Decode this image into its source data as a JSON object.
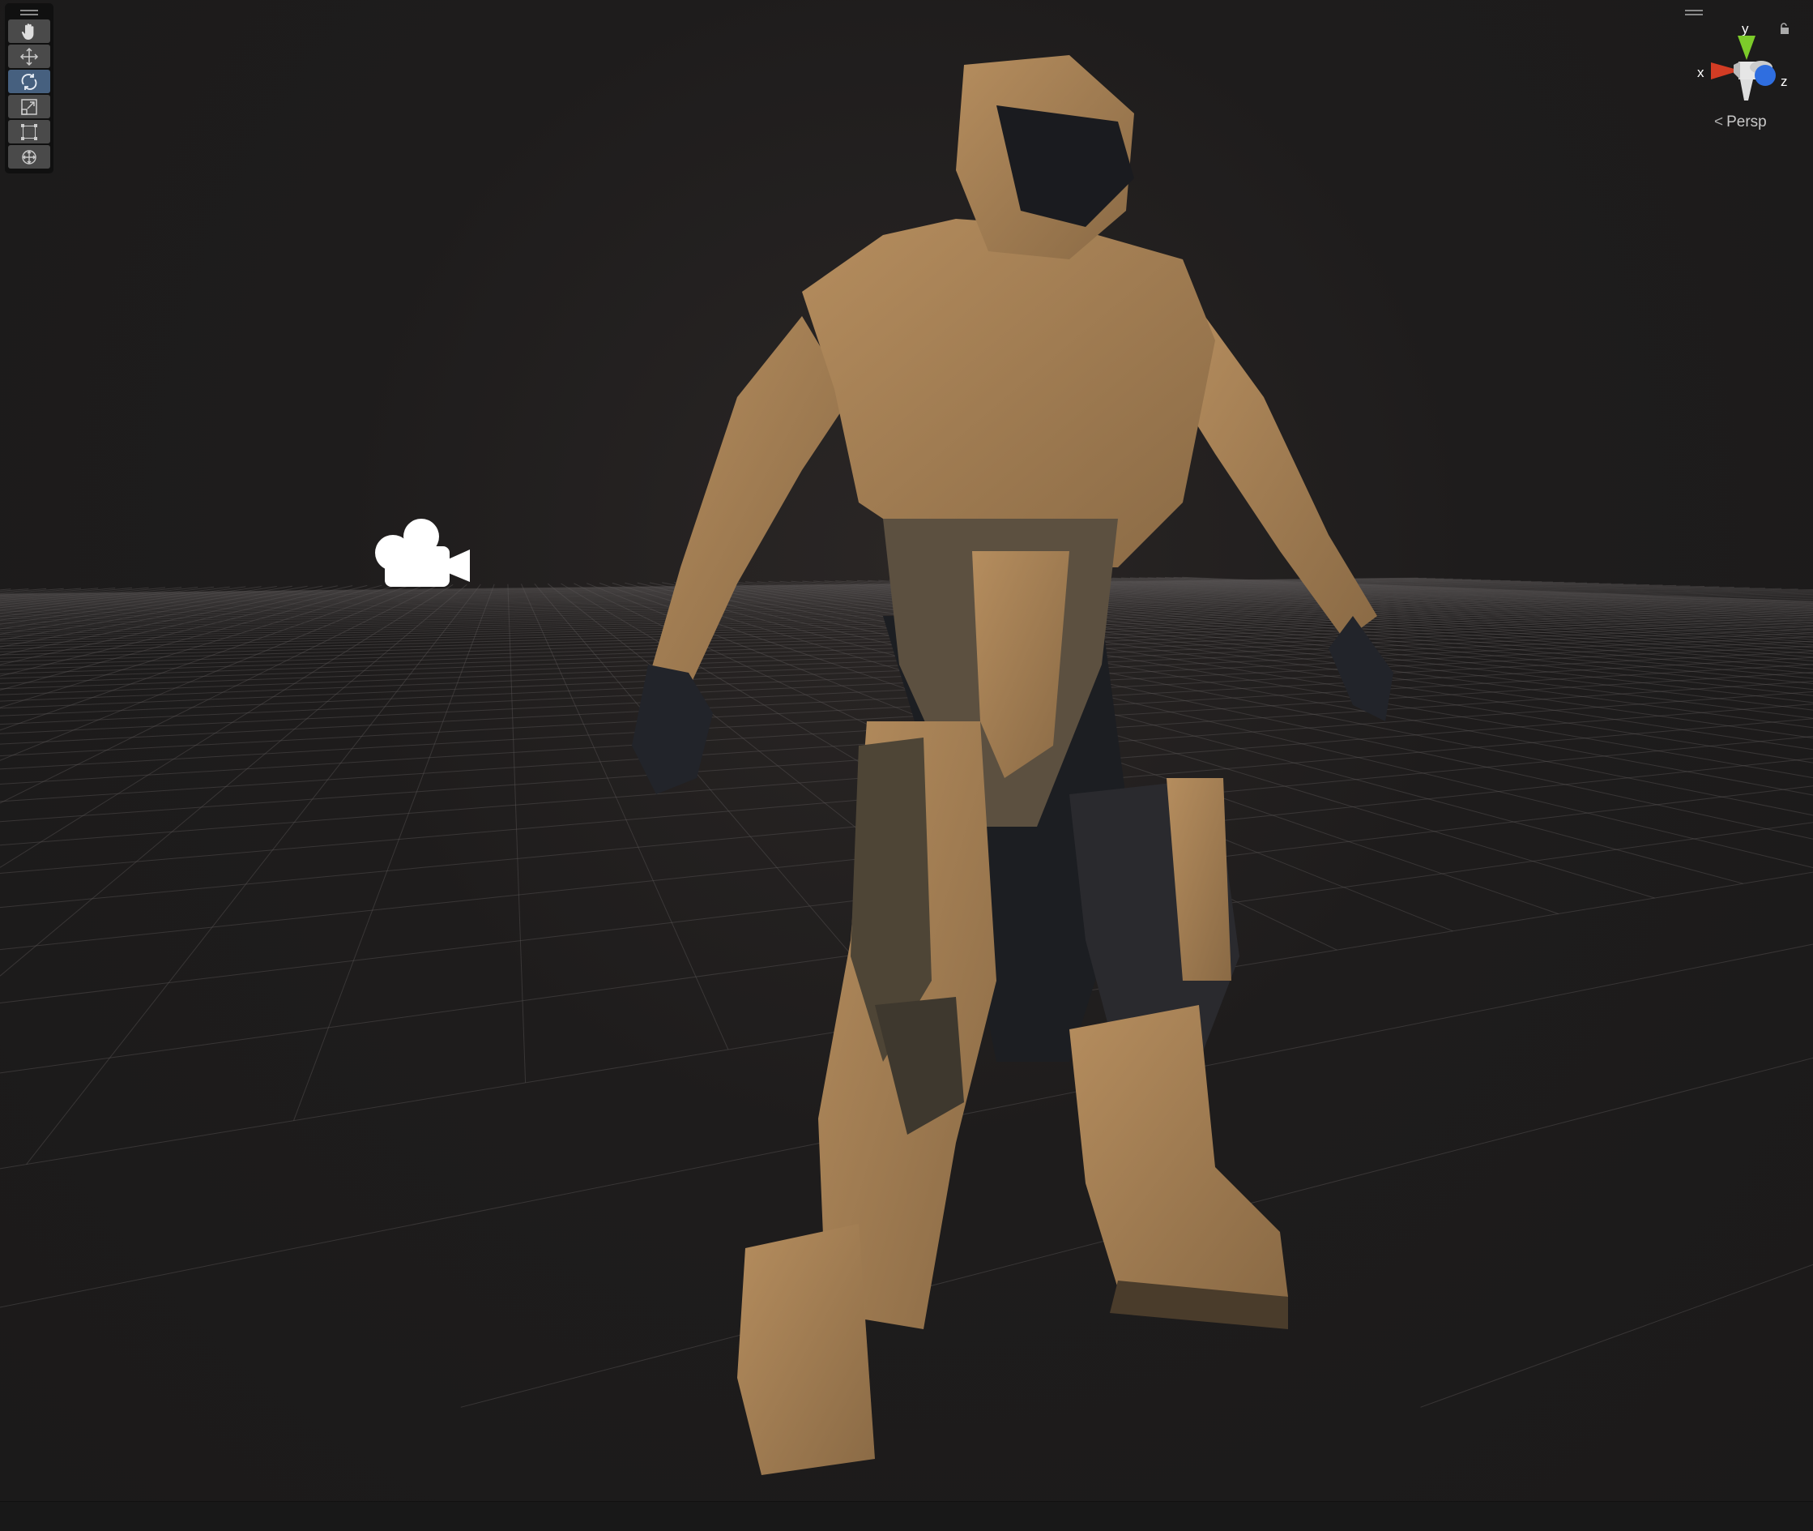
{
  "toolbar": {
    "tools": [
      {
        "name": "hand-tool",
        "icon": "hand-icon",
        "active": false
      },
      {
        "name": "move-tool",
        "icon": "move-icon",
        "active": false
      },
      {
        "name": "rotate-tool",
        "icon": "rotate-icon",
        "active": true
      },
      {
        "name": "scale-tool",
        "icon": "scale-icon",
        "active": false
      },
      {
        "name": "rect-tool",
        "icon": "rect-transform-icon",
        "active": false
      },
      {
        "name": "transform-tool",
        "icon": "transform-icon",
        "active": false
      }
    ]
  },
  "gizmo": {
    "x_label": "x",
    "y_label": "y",
    "z_label": "z",
    "projection_label": "Persp",
    "colors": {
      "x": "#d23c24",
      "y": "#7ccb2a",
      "z": "#2f6ee0"
    }
  },
  "scene": {
    "background": "#1e1c1c",
    "grid_color": "#5a5656",
    "armor_color": "#a57f55"
  }
}
